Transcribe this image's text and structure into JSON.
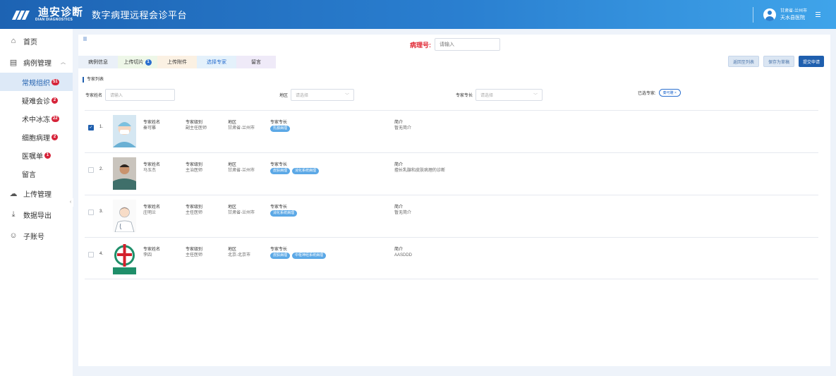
{
  "brand": {
    "name_cn": "迪安诊断",
    "name_en": "DIAN DIAGNOSTICS",
    "platform": "数字病理远程会诊平台"
  },
  "user": {
    "region": "甘肃省-兰州市",
    "hospital": "天水县医院"
  },
  "sidebar": {
    "items": [
      {
        "label": "首页",
        "icon": "home-icon"
      },
      {
        "label": "病例管理",
        "icon": "clipboard-icon"
      },
      {
        "label": "上传管理",
        "icon": "upload-cloud-icon"
      },
      {
        "label": "数据导出",
        "icon": "download-icon"
      },
      {
        "label": "子账号",
        "icon": "users-icon"
      }
    ],
    "sub_items": [
      {
        "label": "常规组织",
        "badge": "51"
      },
      {
        "label": "疑难会诊",
        "badge": "2"
      },
      {
        "label": "术中冰冻",
        "badge": "22"
      },
      {
        "label": "细胞病理",
        "badge": "2"
      },
      {
        "label": "医嘱单",
        "badge": "1"
      },
      {
        "label": "留言",
        "badge": ""
      }
    ]
  },
  "case": {
    "label": "病理号:",
    "placeholder": "请输入"
  },
  "tabs": [
    {
      "label": "病例信息",
      "badge": ""
    },
    {
      "label": "上传切片",
      "badge": "1"
    },
    {
      "label": "上传附件",
      "badge": ""
    },
    {
      "label": "选择专家",
      "badge": ""
    },
    {
      "label": "留言",
      "badge": ""
    }
  ],
  "actions": {
    "back": "返回至列表",
    "save_draft": "保存为草稿",
    "submit": "提交申请"
  },
  "section_title": "专家列表",
  "filters": {
    "name_label": "专家姓名",
    "name_placeholder": "请输入",
    "region_label": "地区",
    "region_placeholder": "请选择",
    "specialty_label": "专家专长",
    "specialty_placeholder": "请选择",
    "selected_label": "已选专家:",
    "selected_chip": "秦可雕 ×"
  },
  "field_labels": {
    "name": "专家姓名",
    "level": "专家级别",
    "region": "地区",
    "specialty": "专家专长",
    "intro": "简介"
  },
  "experts": [
    {
      "index": "1.",
      "name": "秦可雕",
      "level": "副主任医师",
      "region": "甘肃省-兰州市",
      "specialties": [
        "乳腺病理"
      ],
      "intro": "暂无简介",
      "checked": true
    },
    {
      "index": "2.",
      "name": "马玉杰",
      "level": "主治医师",
      "region": "甘肃省-兰州市",
      "specialties": [
        "皮肤病理",
        "消化系统病理"
      ],
      "intro": "擅长乳腺和皮肤病理的诊断",
      "checked": false
    },
    {
      "index": "3.",
      "name": "庄明兰",
      "level": "主任医师",
      "region": "甘肃省-兰州市",
      "specialties": [
        "消化系统病理"
      ],
      "intro": "暂无简介",
      "checked": false
    },
    {
      "index": "4.",
      "name": "李四",
      "level": "主任医师",
      "region": "北京-北京市",
      "specialties": [
        "皮肤病理",
        "中枢神经系统病理"
      ],
      "intro": "AASDDD",
      "checked": false
    }
  ],
  "colors": {
    "primary": "#1f5fae",
    "header_start": "#1d63b3",
    "header_end": "#3fa4ea",
    "badge_red": "#d6243a",
    "tag_blue": "#5ba8e6",
    "case_label_red": "#e0232f"
  }
}
